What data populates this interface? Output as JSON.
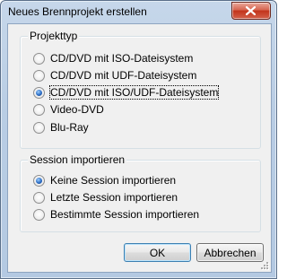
{
  "window": {
    "title": "Neues Brennprojekt erstellen"
  },
  "project_type": {
    "legend": "Projekttyp",
    "options": [
      {
        "label": "CD/DVD mit ISO-Dateisystem",
        "checked": false
      },
      {
        "label": "CD/DVD mit UDF-Dateisystem",
        "checked": false
      },
      {
        "label": "CD/DVD mit ISO/UDF-Dateisystem",
        "checked": true
      },
      {
        "label": "Video-DVD",
        "checked": false
      },
      {
        "label": "Blu-Ray",
        "checked": false
      }
    ]
  },
  "session_import": {
    "legend": "Session importieren",
    "options": [
      {
        "label": "Keine Session importieren",
        "checked": true
      },
      {
        "label": "Letzte Session importieren",
        "checked": false
      },
      {
        "label": "Bestimmte Session importieren",
        "checked": false
      }
    ]
  },
  "buttons": {
    "ok": "OK",
    "cancel": "Abbrechen"
  },
  "icons": {
    "close": "close-icon",
    "resize": "resize-grip-icon"
  }
}
